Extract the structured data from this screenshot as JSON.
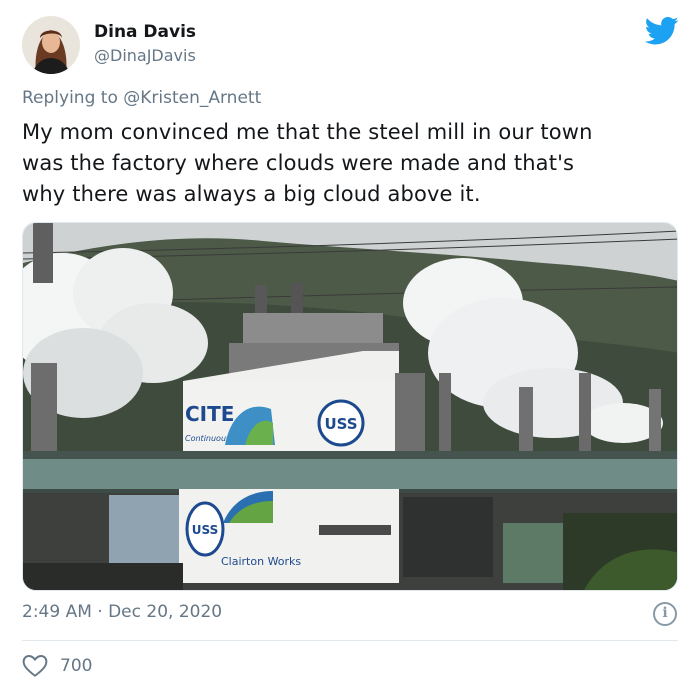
{
  "author": {
    "name": "Dina Davis",
    "handle": "@DinaJDavis"
  },
  "reply": {
    "prefix": "Replying to",
    "mention": "@Kristen_Arnett"
  },
  "tweet": {
    "lines": [
      "My mom convinced me that the steel mill in our town",
      "was the factory where clouds were made and that's",
      "why there was always a big cloud above it."
    ]
  },
  "photo": {
    "sign_cite": "CITE",
    "sign_continuous": "Continuous",
    "sign_uss_top": "USS",
    "sign_uss_bottom": "USS",
    "sign_clairton": "Clairton Works"
  },
  "meta": {
    "timestamp": "2:49 AM · Dec 20, 2020",
    "likes": "700"
  },
  "icons": {
    "bird": "twitter-bird-icon",
    "info": "info-icon",
    "like": "heart-icon"
  },
  "colors": {
    "twitter_blue": "#1da1f2",
    "secondary_text": "#657786",
    "primary_text": "#14171a"
  }
}
